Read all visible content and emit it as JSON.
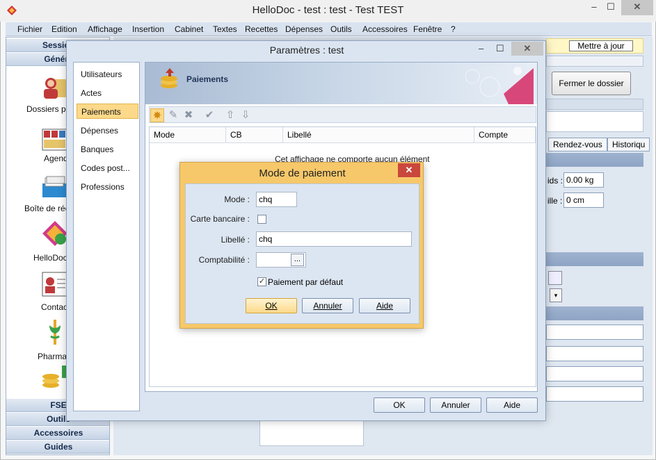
{
  "window": {
    "title": "HelloDoc - test : test - Test TEST",
    "minimize": "–",
    "maximize": "☐",
    "close": "✕"
  },
  "menu": [
    "Fichier",
    "Edition",
    "Affichage",
    "Insertion",
    "Cabinet",
    "Textes",
    "Recettes",
    "Dépenses",
    "Outils",
    "Accessoires",
    "Fenêtre",
    "?"
  ],
  "sidebar": {
    "top_sections": [
      "Session",
      "Généra"
    ],
    "items": [
      "Dossiers pa",
      "Agend",
      "Boîte de réc",
      "HelloDoc",
      "Contac",
      "Pharmac"
    ],
    "bottom_sections": [
      "FSE",
      "Outils",
      "Accessoires",
      "Guides"
    ]
  },
  "background": {
    "update_button": "Mettre à jour",
    "close_file_button": "Fermer le dossier",
    "tabs": [
      "Rendez-vous",
      "Historiqu"
    ],
    "poids_label": "ids :",
    "poids_value": "0.00 kg",
    "taille_label": "ille :",
    "taille_value": "0 cm"
  },
  "param": {
    "title": "Paramètres : test",
    "nav": [
      "Utilisateurs",
      "Actes",
      "Paiements",
      "Dépenses",
      "Banques",
      "Codes post...",
      "Professions"
    ],
    "selected_index": 2,
    "section_title": "Paiements",
    "columns": [
      "Mode",
      "CB",
      "Libellé",
      "Compte"
    ],
    "empty_message": "Cet affichage ne comporte aucun élément",
    "ok": "OK",
    "cancel": "Annuler",
    "help": "Aide"
  },
  "mode_dialog": {
    "title": "Mode de paiement",
    "mode_label": "Mode :",
    "mode_value": "chq",
    "card_label": "Carte bancaire :",
    "card_checked": false,
    "libelle_label": "Libellé :",
    "libelle_value": "chq",
    "compta_label": "Comptabilité :",
    "compta_value": "",
    "browse": "...",
    "default_label": "Paiement par défaut",
    "default_checked": true,
    "ok": "OK",
    "cancel": "Annuler",
    "help": "Aide"
  },
  "colors": {
    "accent": "#f6c86a",
    "selection": "#fcd98a",
    "header": "#c6d4e6"
  }
}
